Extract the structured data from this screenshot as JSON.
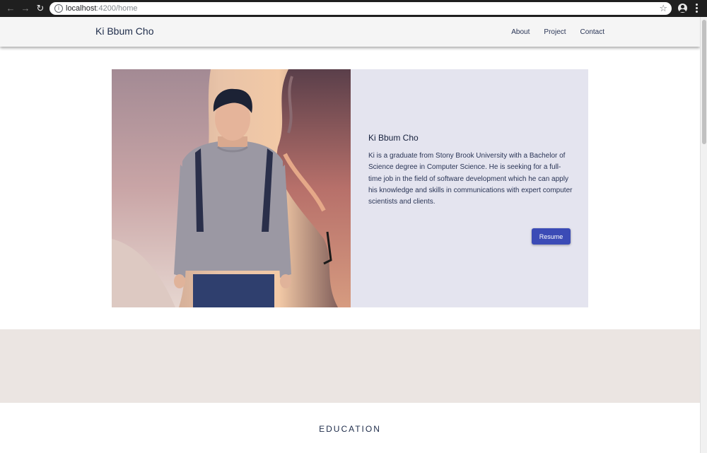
{
  "browser": {
    "url_host": "localhost",
    "url_path": ":4200/home",
    "icons": [
      "back-arrow-icon",
      "forward-arrow-icon",
      "reload-icon",
      "info-icon",
      "star-icon",
      "account-icon",
      "more-menu-icon"
    ]
  },
  "nav": {
    "brand": "Ki Bbum Cho",
    "links": [
      "About",
      "Project",
      "Contact"
    ]
  },
  "hero": {
    "name": "Ki Bbum Cho",
    "bio": "Ki is a graduate from Stony Brook University with a Bachelor of Science degree in Computer Science. He is seeking for a full-time job in the field of software development which he can apply his knowledge and skills in communications with expert computer scientists and clients.",
    "resume_label": "Resume"
  },
  "sections": {
    "education_title": "EDUCATION"
  },
  "colors": {
    "nav_bg": "#f5f5f5",
    "card_bg": "#e4e4ef",
    "band_bg": "#ebe5e2",
    "button": "#3b4bb6",
    "text_dark": "#1e2c4a"
  }
}
